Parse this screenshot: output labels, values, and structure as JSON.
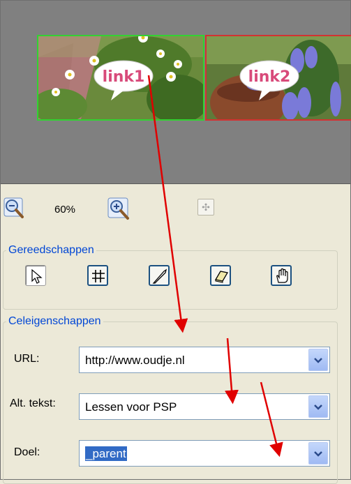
{
  "preview": {
    "hotspots": [
      {
        "label": "link1",
        "border_color": "#32d232"
      },
      {
        "label": "link2",
        "border_color": "#d23232"
      }
    ],
    "background": "#808080"
  },
  "zoombar": {
    "zoom_out_icon": "zoom-out-icon",
    "zoom_value": "60%",
    "zoom_in_icon": "zoom-in-icon",
    "move_icon": "move-icon"
  },
  "tools_panel": {
    "title": "Gereedschappen",
    "tools": [
      {
        "name": "pointer-icon",
        "active": true
      },
      {
        "name": "grid-icon",
        "active": false
      },
      {
        "name": "knife-icon",
        "active": false
      },
      {
        "name": "eraser-icon",
        "active": false
      },
      {
        "name": "hand-icon",
        "active": false
      }
    ]
  },
  "cell_panel": {
    "title": "Celeigenschappen",
    "url_label": "URL:",
    "url_value": "http://www.oudje.nl",
    "alt_label": "Alt. tekst:",
    "alt_value": "Lessen voor PSP",
    "target_label": "Doel:",
    "target_value": "_parent"
  },
  "annotation_color": "#e00000"
}
